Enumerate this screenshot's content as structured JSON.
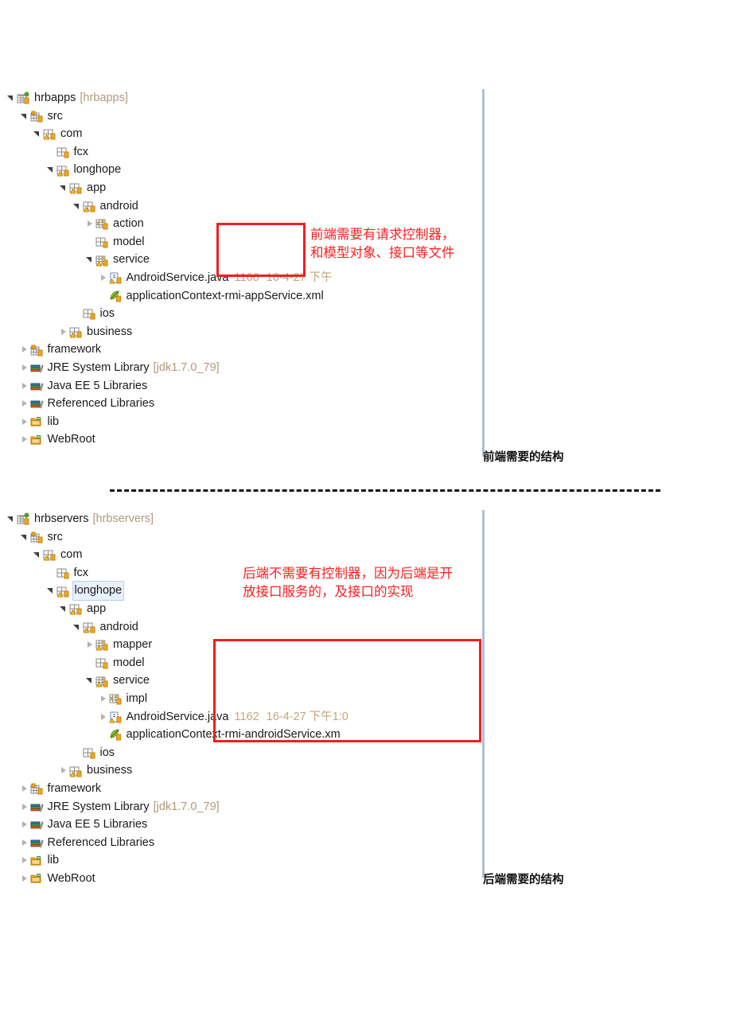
{
  "document": {
    "separator_style": "dashed-horizontal-rule"
  },
  "colors": {
    "annotation_red": "#fb2020",
    "highlight_box_red": "#f21f1f",
    "dim_text": "#b09a7a",
    "meta_text": "#c0a878",
    "selection_bg": "#e8f0fb",
    "scroll_rule": "#aebed4"
  },
  "panels": [
    {
      "id": "front-end",
      "caption": "前端需要的结构",
      "annotation": "前端需要有请求控制器，\n和模型对象、接口等文件",
      "tree": [
        {
          "depth": 0,
          "arrow": "expanded",
          "icon": "java-project-icon",
          "label": "hrbapps",
          "dim": "[hrbapps]"
        },
        {
          "depth": 1,
          "arrow": "expanded",
          "icon": "source-folder-icon",
          "label": "src"
        },
        {
          "depth": 2,
          "arrow": "expanded",
          "icon": "package-warn-icon",
          "label": "com"
        },
        {
          "depth": 3,
          "arrow": "none",
          "icon": "package-icon",
          "label": "fcx"
        },
        {
          "depth": 3,
          "arrow": "expanded",
          "icon": "package-warn-icon",
          "label": "longhope"
        },
        {
          "depth": 4,
          "arrow": "expanded",
          "icon": "package-warn-icon",
          "label": "app"
        },
        {
          "depth": 5,
          "arrow": "expanded",
          "icon": "package-warn-icon",
          "label": "android"
        },
        {
          "depth": 6,
          "arrow": "collapsed",
          "icon": "package-full-icon",
          "label": "action"
        },
        {
          "depth": 6,
          "arrow": "none",
          "icon": "package-icon",
          "label": "model"
        },
        {
          "depth": 6,
          "arrow": "expanded",
          "icon": "package-warn-full-icon",
          "label": "service"
        },
        {
          "depth": 7,
          "arrow": "collapsed",
          "icon": "java-file-warn-icon",
          "label": "AndroidService.java",
          "meta": "1160",
          "meta2": "16-4-27 下午"
        },
        {
          "depth": 7,
          "arrow": "none",
          "icon": "spring-xml-icon",
          "label": "applicationContext-rmi-appService.xml"
        },
        {
          "depth": 5,
          "arrow": "none",
          "icon": "package-icon",
          "label": "ios"
        },
        {
          "depth": 4,
          "arrow": "collapsed",
          "icon": "package-warn-icon",
          "label": "business"
        },
        {
          "depth": 1,
          "arrow": "collapsed",
          "icon": "source-folder-icon",
          "label": "framework"
        },
        {
          "depth": 1,
          "arrow": "collapsed",
          "icon": "library-icon",
          "label": "JRE System Library",
          "dim": "[jdk1.7.0_79]"
        },
        {
          "depth": 1,
          "arrow": "collapsed",
          "icon": "library-icon",
          "label": "Java EE 5 Libraries"
        },
        {
          "depth": 1,
          "arrow": "collapsed",
          "icon": "library-icon",
          "label": "Referenced Libraries"
        },
        {
          "depth": 1,
          "arrow": "collapsed",
          "icon": "folder-icon",
          "label": "lib"
        },
        {
          "depth": 1,
          "arrow": "collapsed",
          "icon": "folder-icon",
          "label": "WebRoot"
        }
      ]
    },
    {
      "id": "back-end",
      "caption": "后端需要的结构",
      "annotation": "后端不需要有控制器，因为后端是开\n放接口服务的，及接口的实现",
      "tree": [
        {
          "depth": 0,
          "arrow": "expanded",
          "icon": "java-project-icon",
          "label": "hrbservers",
          "dim": "[hrbservers]"
        },
        {
          "depth": 1,
          "arrow": "expanded",
          "icon": "source-folder-icon",
          "label": "src"
        },
        {
          "depth": 2,
          "arrow": "expanded",
          "icon": "package-warn-icon",
          "label": "com"
        },
        {
          "depth": 3,
          "arrow": "none",
          "icon": "package-icon",
          "label": "fcx"
        },
        {
          "depth": 3,
          "arrow": "expanded",
          "icon": "package-warn-icon",
          "label": "longhope",
          "selected": true
        },
        {
          "depth": 4,
          "arrow": "expanded",
          "icon": "package-warn-icon",
          "label": "app"
        },
        {
          "depth": 5,
          "arrow": "expanded",
          "icon": "package-warn-icon",
          "label": "android"
        },
        {
          "depth": 6,
          "arrow": "collapsed",
          "icon": "package-warn-full-icon",
          "label": "mapper"
        },
        {
          "depth": 6,
          "arrow": "none",
          "icon": "package-icon",
          "label": "model"
        },
        {
          "depth": 6,
          "arrow": "expanded",
          "icon": "package-warn-full-icon",
          "label": "service"
        },
        {
          "depth": 7,
          "arrow": "collapsed",
          "icon": "package-full-icon",
          "label": "impl"
        },
        {
          "depth": 7,
          "arrow": "collapsed",
          "icon": "java-file-warn-icon",
          "label": "AndroidService.java",
          "meta": "1162",
          "meta2": "16-4-27 下午1:0"
        },
        {
          "depth": 7,
          "arrow": "none",
          "icon": "spring-xml-icon",
          "label": "applicationContext-rmi-androidService.xm"
        },
        {
          "depth": 5,
          "arrow": "none",
          "icon": "package-icon",
          "label": "ios"
        },
        {
          "depth": 4,
          "arrow": "collapsed",
          "icon": "package-warn-icon",
          "label": "business"
        },
        {
          "depth": 1,
          "arrow": "collapsed",
          "icon": "source-folder-icon",
          "label": "framework"
        },
        {
          "depth": 1,
          "arrow": "collapsed",
          "icon": "library-icon",
          "label": "JRE System Library",
          "dim": "[jdk1.7.0_79]"
        },
        {
          "depth": 1,
          "arrow": "collapsed",
          "icon": "library-icon",
          "label": "Java EE 5 Libraries"
        },
        {
          "depth": 1,
          "arrow": "collapsed",
          "icon": "library-icon",
          "label": "Referenced Libraries"
        },
        {
          "depth": 1,
          "arrow": "collapsed",
          "icon": "folder-icon",
          "label": "lib"
        },
        {
          "depth": 1,
          "arrow": "collapsed",
          "icon": "folder-icon",
          "label": "WebRoot"
        }
      ]
    }
  ]
}
